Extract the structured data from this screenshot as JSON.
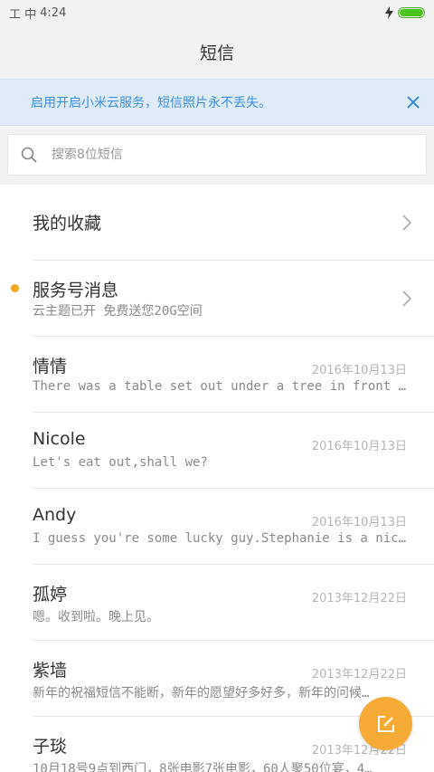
{
  "status_bar": {
    "signal": "工 中",
    "time": "4:24",
    "battery_level": 1.0,
    "charging_icon": "bolt-icon",
    "battery_color": "#4cc41e"
  },
  "header": {
    "title": "短信"
  },
  "notice": {
    "text": "启用开启小米云服务，短信照片永不丢失。",
    "close_icon": "close-icon",
    "color": "#3b8fe0"
  },
  "search": {
    "placeholder": "搜索8位短信",
    "icon": "search-icon"
  },
  "conversations": [
    {
      "name": "我的收藏",
      "type": "folder"
    },
    {
      "name": "服务号消息",
      "preview": "云主题已开 免费送您20G空间",
      "type": "folder",
      "unread": true
    },
    {
      "name": "情情",
      "date": "2016年10月13日",
      "preview": "There was a table set out under a tree in front of the…"
    },
    {
      "name": "Nicole",
      "date": "2016年10月13日",
      "preview": "Let's eat out,shall we?"
    },
    {
      "name": "Andy",
      "date": "2016年10月13日",
      "preview": "I guess you're some lucky guy.Stephanie is a nice girl."
    },
    {
      "name": "孤婷",
      "date": "2013年12月22日",
      "preview": "嗯。收到啦。晚上见。"
    },
    {
      "name": "紫墙",
      "date": "2013年12月22日",
      "preview": "新年的祝福短信不能断，新年的愿望好多好多，新年的问候…"
    },
    {
      "name": "子琰",
      "date": "2013年12月22日",
      "preview": "10月18号9点到西门，8张电影7张电影，60人聚50位宴，4…"
    }
  ],
  "fab": {
    "icon": "compose-icon",
    "color": "#f5ab35"
  }
}
